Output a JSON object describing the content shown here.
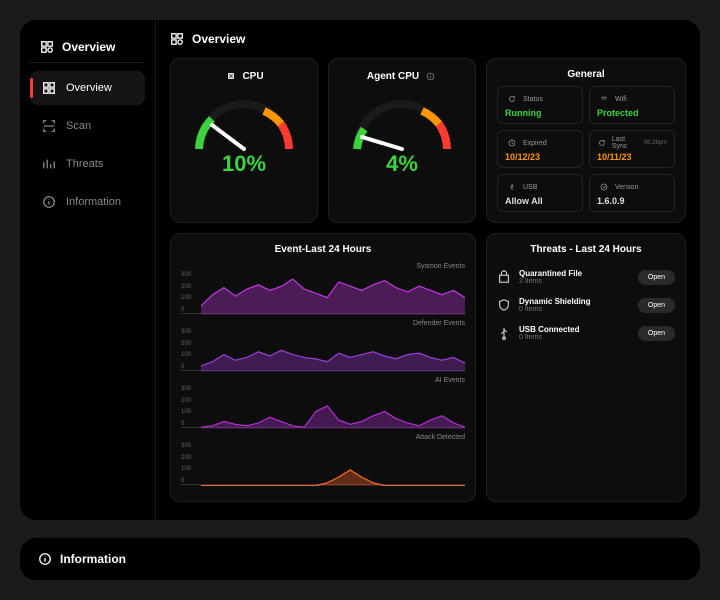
{
  "header": {
    "title": "Overview"
  },
  "sidebar": {
    "items": [
      {
        "label": "Overview"
      },
      {
        "label": "Scan"
      },
      {
        "label": "Threats"
      },
      {
        "label": "Information"
      }
    ]
  },
  "cpu": {
    "title": "CPU",
    "value": "10%"
  },
  "agent_cpu": {
    "title": "Agent CPU",
    "value": "4%"
  },
  "general": {
    "title": "General",
    "status_label": "Status",
    "status_value": "Running",
    "wifi_label": "Wifi",
    "wifi_value": "Protected",
    "expired_label": "Expired",
    "expired_value": "10/12/23",
    "sync_label": "Last Sync",
    "sync_time": "06:28pm",
    "sync_value": "10/11/23",
    "usb_label": "USB",
    "usb_value": "Allow All",
    "version_label": "Version",
    "version_value": "1.6.0.9"
  },
  "events": {
    "title": "Event-Last 24 Hours",
    "ticks": [
      "300",
      "200",
      "100",
      "0"
    ],
    "rows": [
      {
        "label": "Sysmon Events"
      },
      {
        "label": "Defender Events"
      },
      {
        "label": "AI Events"
      },
      {
        "label": "Attack Detected"
      }
    ]
  },
  "threats": {
    "title": "Threats - Last 24 Hours",
    "open_label": "Open",
    "items": [
      {
        "name": "Quarantined File",
        "sub": "2 Items"
      },
      {
        "name": "Dynamic Shielding",
        "sub": "0 Items"
      },
      {
        "name": "USB Connected",
        "sub": "0 Items"
      }
    ]
  },
  "info_card": {
    "title": "Information"
  },
  "chart_data": [
    {
      "type": "area",
      "title": "Sysmon Events",
      "ylim": [
        0,
        300
      ],
      "x": [
        0,
        1,
        2,
        3,
        4,
        5,
        6,
        7,
        8,
        9,
        10,
        11,
        12,
        13,
        14,
        15,
        16,
        17,
        18,
        19,
        20,
        21,
        22,
        23
      ],
      "values": [
        60,
        140,
        190,
        130,
        180,
        210,
        170,
        200,
        250,
        180,
        150,
        120,
        230,
        200,
        170,
        210,
        240,
        190,
        160,
        200,
        170,
        140,
        170,
        120
      ]
    },
    {
      "type": "area",
      "title": "Defender Events",
      "ylim": [
        0,
        300
      ],
      "x": [
        0,
        1,
        2,
        3,
        4,
        5,
        6,
        7,
        8,
        9,
        10,
        11,
        12,
        13,
        14,
        15,
        16,
        17,
        18,
        19,
        20,
        21,
        22,
        23
      ],
      "values": [
        40,
        70,
        120,
        80,
        100,
        140,
        110,
        150,
        120,
        100,
        90,
        70,
        130,
        100,
        120,
        140,
        110,
        90,
        120,
        130,
        100,
        80,
        100,
        60
      ]
    },
    {
      "type": "area",
      "title": "AI Events",
      "ylim": [
        0,
        300
      ],
      "x": [
        0,
        1,
        2,
        3,
        4,
        5,
        6,
        7,
        8,
        9,
        10,
        11,
        12,
        13,
        14,
        15,
        16,
        17,
        18,
        19,
        20,
        21,
        22,
        23
      ],
      "values": [
        10,
        20,
        50,
        30,
        20,
        40,
        80,
        50,
        20,
        10,
        120,
        160,
        60,
        30,
        50,
        90,
        120,
        70,
        40,
        20,
        60,
        90,
        40,
        10
      ]
    },
    {
      "type": "area",
      "title": "Attack Detected",
      "ylim": [
        0,
        300
      ],
      "x": [
        0,
        1,
        2,
        3,
        4,
        5,
        6,
        7,
        8,
        9,
        10,
        11,
        12,
        13,
        14,
        15,
        16,
        17,
        18,
        19,
        20,
        21,
        22,
        23
      ],
      "values": [
        0,
        0,
        0,
        0,
        0,
        0,
        0,
        0,
        0,
        0,
        0,
        20,
        60,
        110,
        60,
        20,
        0,
        0,
        0,
        0,
        0,
        0,
        0,
        0
      ]
    }
  ],
  "chart_colors": [
    "#c038e0",
    "#9d3dd8",
    "#b030d0",
    "#ff6a2a"
  ]
}
